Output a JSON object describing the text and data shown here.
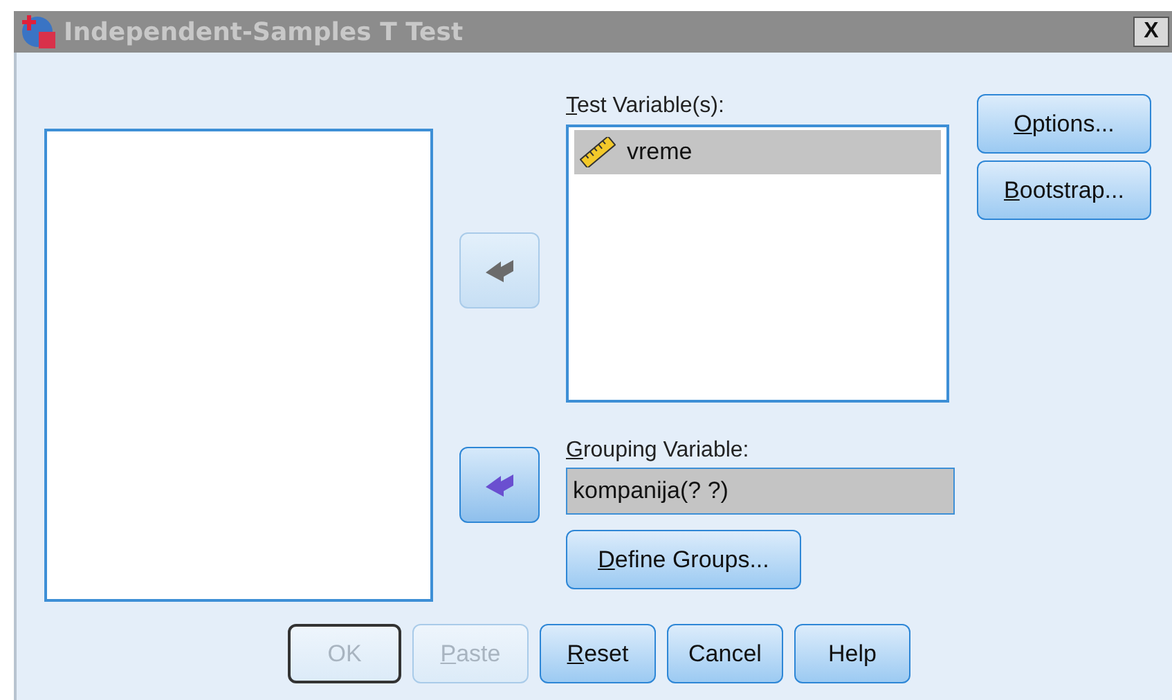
{
  "window": {
    "title": "Independent-Samples T Test",
    "close": "X"
  },
  "test_variables": {
    "label": {
      "key": "T",
      "rest": "est Variable(s):"
    },
    "items": [
      {
        "name": "vreme",
        "kind": "scale",
        "selected": true
      }
    ]
  },
  "move_buttons": [
    {
      "disabled": true
    },
    {
      "disabled": false
    }
  ],
  "grouping_variable": {
    "label": {
      "key": "G",
      "rest": "rouping Variable:"
    },
    "value": "kompanija(? ?)"
  },
  "define_groups": {
    "key": "D",
    "rest": "efine Groups...",
    "disabled": false
  },
  "side_buttons": [
    {
      "key": "O",
      "rest": "ptions...",
      "disabled": false
    },
    {
      "key": "B",
      "rest": "ootstrap...",
      "disabled": false
    }
  ],
  "bottom_buttons": [
    {
      "rest": "OK",
      "disabled": true,
      "default": true
    },
    {
      "key": "P",
      "rest": "aste",
      "disabled": true,
      "default": false
    },
    {
      "key": "R",
      "rest": "eset",
      "disabled": false,
      "default": false
    },
    {
      "rest": "Cancel",
      "disabled": false,
      "default": false
    },
    {
      "rest": "Help",
      "disabled": false,
      "default": false
    }
  ]
}
